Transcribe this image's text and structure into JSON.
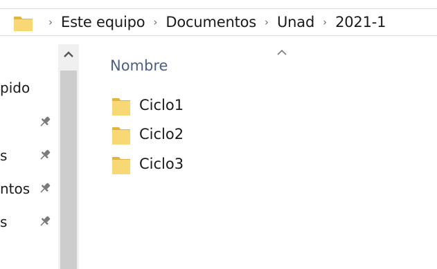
{
  "address_bar": {
    "folder_icon": "folder-icon",
    "separator": "›",
    "breadcrumbs": [
      "Este equipo",
      "Documentos",
      "Unad",
      "2021-1"
    ]
  },
  "nav_pane": {
    "items": [
      {
        "label": "pido",
        "pinned": false
      },
      {
        "label": "",
        "pinned": true
      },
      {
        "label": "s",
        "pinned": true
      },
      {
        "label": "ntos",
        "pinned": true
      },
      {
        "label": "s",
        "pinned": true
      }
    ],
    "pin_icon": "pin-icon"
  },
  "scrollbar": {
    "up_icon": "chevron-up-icon"
  },
  "content": {
    "sort_icon": "sort-ascending-icon",
    "column_header": "Nombre",
    "files": [
      {
        "name": "Ciclo1",
        "icon": "folder-icon"
      },
      {
        "name": "Ciclo2",
        "icon": "folder-icon"
      },
      {
        "name": "Ciclo3",
        "icon": "folder-icon"
      }
    ]
  },
  "colors": {
    "folder_body": "#f8d775",
    "folder_tab": "#e3b341",
    "header_text": "#4b5f87",
    "scroll_track": "#f0f0f0",
    "scroll_thumb": "#cdcdcd"
  }
}
